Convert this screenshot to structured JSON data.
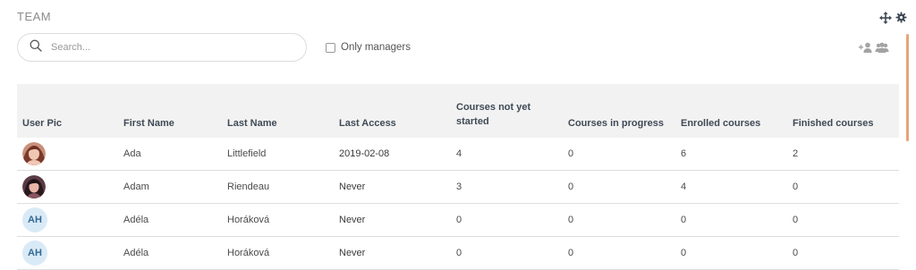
{
  "panel": {
    "title": "TEAM"
  },
  "search": {
    "placeholder": "Search..."
  },
  "filter": {
    "only_managers_label": "Only managers",
    "only_managers_checked": false
  },
  "icons": {
    "move": "move-icon",
    "settings": "gear-icon",
    "add_user": "add-user-icon",
    "group": "group-icon",
    "search": "search-icon"
  },
  "colors": {
    "accent": "#e8a37a",
    "initials_bg": "#d9eaf7",
    "header_bg": "#f2f2f2"
  },
  "table": {
    "headers": {
      "user_pic": "User Pic",
      "first_name": "First Name",
      "last_name": "Last Name",
      "last_access": "Last Access",
      "not_started": "Courses not yet started",
      "in_progress": "Courses in progress",
      "enrolled": "Enrolled courses",
      "finished": "Finished courses"
    },
    "rows": [
      {
        "avatar": "photo",
        "initials": "",
        "first_name": "Ada",
        "last_name": "Littlefield",
        "last_access": "2019-02-08",
        "not_started": "4",
        "in_progress": "0",
        "enrolled": "6",
        "finished": "2"
      },
      {
        "avatar": "photo",
        "initials": "",
        "first_name": "Adam",
        "last_name": "Riendeau",
        "last_access": "Never",
        "not_started": "3",
        "in_progress": "0",
        "enrolled": "4",
        "finished": "0"
      },
      {
        "avatar": "initials",
        "initials": "AH",
        "first_name": "Adéla",
        "last_name": "Horáková",
        "last_access": "Never",
        "not_started": "0",
        "in_progress": "0",
        "enrolled": "0",
        "finished": "0"
      },
      {
        "avatar": "initials",
        "initials": "AH",
        "first_name": "Adéla",
        "last_name": "Horáková",
        "last_access": "Never",
        "not_started": "0",
        "in_progress": "0",
        "enrolled": "0",
        "finished": "0"
      }
    ]
  }
}
